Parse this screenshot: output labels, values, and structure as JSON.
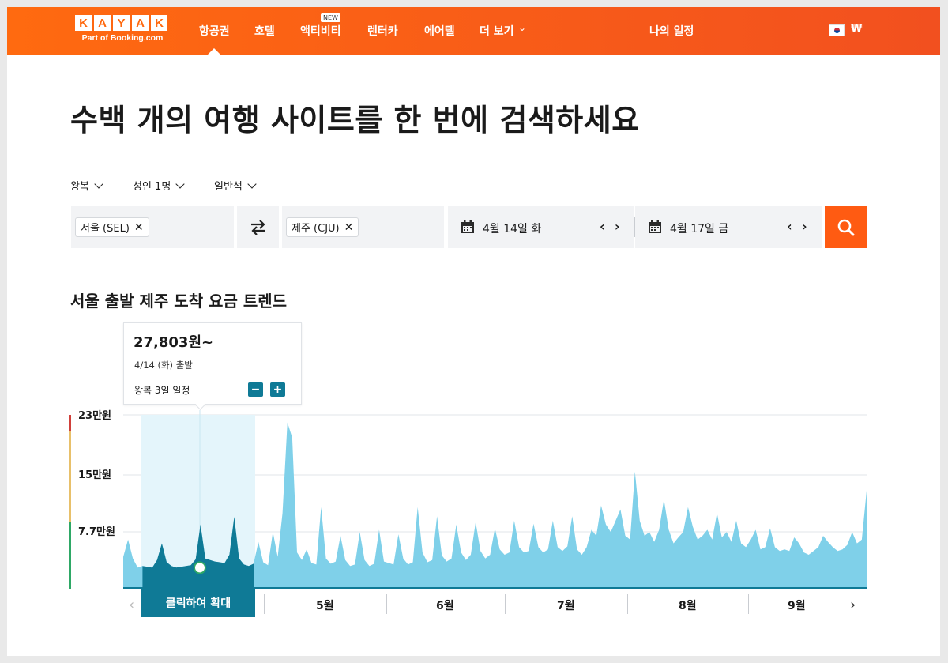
{
  "header": {
    "logo_letters": [
      "K",
      "A",
      "Y",
      "A",
      "K"
    ],
    "logo_sub": "Part of Booking.com",
    "nav": [
      "항공권",
      "호텔",
      "액티비티",
      "렌터카",
      "에어텔",
      "더 보기"
    ],
    "new_badge": "NEW",
    "trips": "나의 일정",
    "currency": "₩",
    "flag_icon": "korea-flag-icon",
    "brand_color": "#ff690f"
  },
  "headline": "수백 개의 여행 사이트를 한 번에 검색하세요",
  "options": {
    "trip_type": "왕복",
    "travelers": "성인 1명",
    "cabin": "일반석"
  },
  "search": {
    "origin": "서울 (SEL)",
    "destination": "제주 (CJU)",
    "depart_date": "4월 14일 화",
    "return_date": "4월 17일 금",
    "swap_icon": "swap-arrows-icon",
    "search_icon": "magnifier-icon",
    "search_color": "#ff5b12"
  },
  "trend": {
    "title": "서울 출발 제주 도착 요금 트렌드",
    "tooltip": {
      "price": "27,803원~",
      "date": "4/14 (화) 출발",
      "duration": "왕복 3일 일정",
      "minus": "−",
      "plus": "+"
    },
    "zoom_label": "클릭하여 확대",
    "months": [
      "5월",
      "6월",
      "7월",
      "8월",
      "9월"
    ]
  },
  "chart_data": {
    "type": "area",
    "y_tick_labels": [
      "23만원",
      "15만원",
      "7.7만원"
    ],
    "ylim": [
      0,
      230000
    ],
    "series_color": "#7fd0e9",
    "selected_color": "#0f7a96",
    "x_start": "4/1",
    "x_end": "9/30",
    "values": [
      42000,
      65000,
      40000,
      28000,
      30000,
      29000,
      27803,
      38000,
      60000,
      35000,
      30000,
      28000,
      29000,
      30000,
      31000,
      39000,
      85000,
      40000,
      38000,
      36000,
      35000,
      34000,
      45000,
      95000,
      40000,
      32000,
      30000,
      33000,
      62000,
      35000,
      31000,
      75000,
      42000,
      100000,
      220000,
      200000,
      48000,
      38000,
      52000,
      34000,
      32000,
      108000,
      40000,
      33000,
      36000,
      70000,
      38000,
      30000,
      32000,
      75000,
      38000,
      30000,
      33000,
      78000,
      36000,
      34000,
      32000,
      72000,
      40000,
      32000,
      35000,
      108000,
      48000,
      35000,
      38000,
      96000,
      44000,
      36000,
      40000,
      85000,
      48000,
      38000,
      45000,
      88000,
      50000,
      40000,
      45000,
      80000,
      52000,
      45000,
      48000,
      90000,
      55000,
      48000,
      50000,
      86000,
      55000,
      48000,
      52000,
      90000,
      55000,
      50000,
      56000,
      96000,
      52000,
      45000,
      55000,
      78000,
      70000,
      110000,
      85000,
      75000,
      90000,
      105000,
      70000,
      65000,
      155000,
      90000,
      70000,
      75000,
      62000,
      78000,
      118000,
      78000,
      60000,
      68000,
      75000,
      108000,
      82000,
      65000,
      70000,
      78000,
      65000,
      100000,
      68000,
      75000,
      62000,
      90000,
      60000,
      55000,
      65000,
      78000,
      52000,
      55000,
      80000,
      55000,
      50000,
      52000,
      50000,
      68000,
      60000,
      48000,
      45000,
      50000,
      55000,
      70000,
      62000,
      55000,
      50000,
      52000,
      58000,
      75000,
      60000,
      65000,
      130000
    ]
  }
}
